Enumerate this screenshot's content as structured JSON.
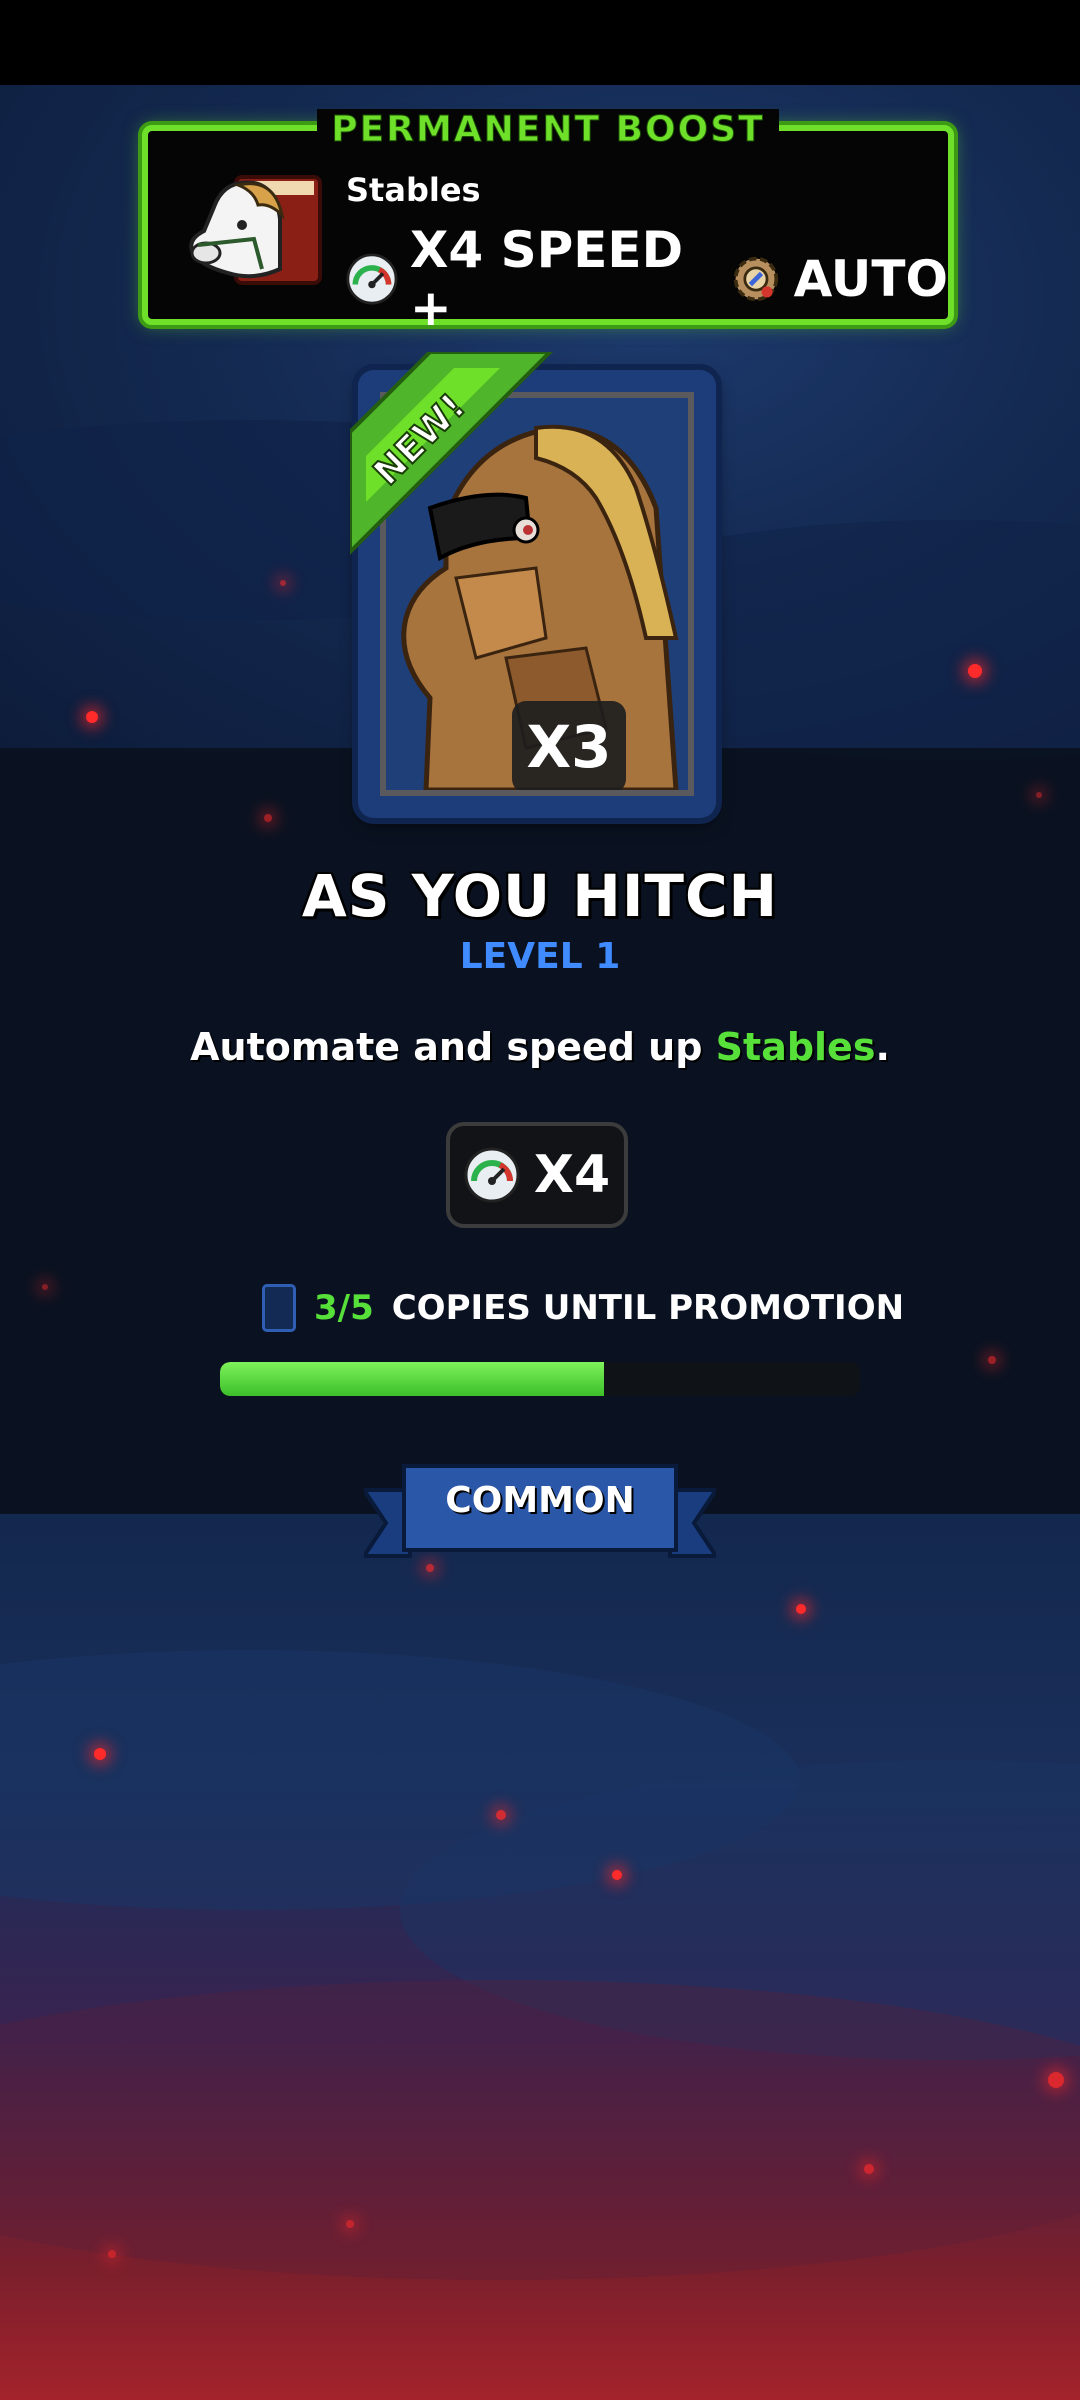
{
  "boost": {
    "title": "PERMANENT BOOST",
    "building": "Stables",
    "speed_text": "X4 SPEED +",
    "auto_text": "AUTO",
    "icons": [
      "horse-stable-icon",
      "speed-gauge-icon",
      "gear-auto-icon"
    ]
  },
  "card": {
    "badge": "NEW!",
    "quantity": "X3",
    "name": "AS YOU HITCH",
    "level": "LEVEL 1",
    "description_prefix": "Automate and speed up ",
    "description_highlight": "Stables",
    "description_suffix": ".",
    "multiplier": "X4",
    "copies_count": "3/5",
    "copies_label": "COPIES UNTIL PROMOTION",
    "progress_fraction": 0.6,
    "rarity": "COMMON"
  },
  "colors": {
    "accent_green": "#6ee02a",
    "level_blue": "#3f8bff",
    "card_blue": "#1d3d7a"
  }
}
